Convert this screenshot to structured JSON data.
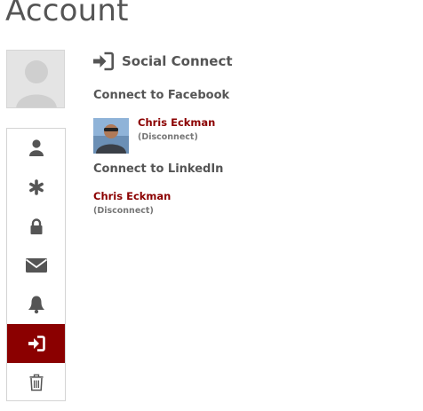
{
  "page": {
    "title": "Account"
  },
  "sidebar": {
    "items": [
      {
        "icon": "user-icon",
        "active": false
      },
      {
        "icon": "asterisk-icon",
        "active": false
      },
      {
        "icon": "lock-icon",
        "active": false
      },
      {
        "icon": "envelope-icon",
        "active": false
      },
      {
        "icon": "bell-icon",
        "active": false
      },
      {
        "icon": "sign-in-icon",
        "active": true
      },
      {
        "icon": "trash-icon",
        "active": false
      }
    ]
  },
  "social": {
    "title": "Social Connect",
    "facebook": {
      "heading": "Connect to Facebook",
      "name": "Chris Eckman",
      "disconnect_open": "(",
      "disconnect": "Disconnect",
      "disconnect_close": ")"
    },
    "linkedin": {
      "heading": "Connect to LinkedIn",
      "name": "Chris Eckman",
      "disconnect_open": "(",
      "disconnect": "Disconnect",
      "disconnect_close": ")"
    }
  },
  "colors": {
    "accent": "#8b0000",
    "text": "#555555",
    "icon": "#555555",
    "border": "#d4d4d4",
    "avatar_bg": "#e4e4e4"
  }
}
